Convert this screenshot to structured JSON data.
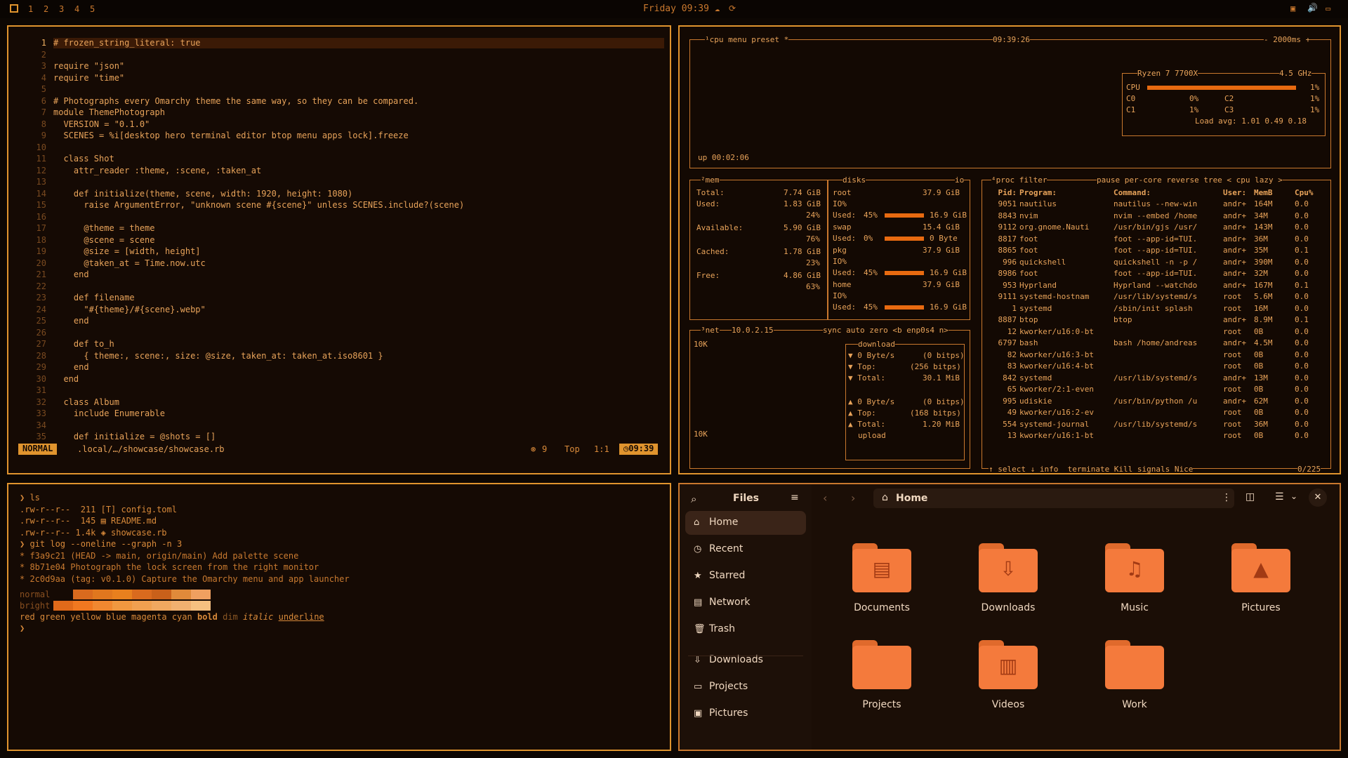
{
  "topbar": {
    "workspaces": [
      "1",
      "2",
      "3",
      "4",
      "5"
    ],
    "clock": "Friday 09:39"
  },
  "editor": {
    "lines": [
      "# frozen_string_literal: true",
      "",
      "require \"json\"",
      "require \"time\"",
      "",
      "# Photographs every Omarchy theme the same way, so they can be compared.",
      "module ThemePhotograph",
      "  VERSION = \"0.1.0\"",
      "  SCENES = %i[desktop hero terminal editor btop menu apps lock].freeze",
      "",
      "  class Shot",
      "    attr_reader :theme, :scene, :taken_at",
      "",
      "    def initialize(theme, scene, width: 1920, height: 1080)",
      "      raise ArgumentError, \"unknown scene #{scene}\" unless SCENES.include?(scene)",
      "",
      "      @theme = theme",
      "      @scene = scene",
      "      @size = [width, height]",
      "      @taken_at = Time.now.utc",
      "    end",
      "",
      "    def filename",
      "      \"#{theme}/#{scene}.webp\"",
      "    end",
      "",
      "    def to_h",
      "      { theme:, scene:, size: @size, taken_at: taken_at.iso8601 }",
      "    end",
      "  end",
      "",
      "  class Album",
      "    include Enumerable",
      "",
      "    def initialize = @shots = []"
    ],
    "status": {
      "mode": "NORMAL",
      "path": ".local/…/showcase/showcase.rb",
      "diag": "9",
      "pos": "Top",
      "cursor": "1:1",
      "time": "09:39"
    }
  },
  "btop": {
    "cpu": {
      "tabs": "¹cpu menu preset *",
      "time": "09:39:26",
      "refresh": "- 2000ms +",
      "model": "Ryzen 7 7700X",
      "freq": "4.5 GHz",
      "cpu_pct": "1%",
      "cores": [
        {
          "name": "C0",
          "pct": "0%"
        },
        {
          "name": "C2",
          "pct": "1%"
        },
        {
          "name": "C1",
          "pct": "1%"
        },
        {
          "name": "C3",
          "pct": "1%"
        }
      ],
      "load": "Load avg: 1.01 0.49 0.18",
      "uptime": "up 00:02:06"
    },
    "mem": {
      "title": "²mem",
      "total_label": "Total:",
      "total": "7.74 GiB",
      "used_label": "Used:",
      "used": "1.83 GiB",
      "used_pct": "24%",
      "avail_label": "Available:",
      "avail": "5.90 GiB",
      "avail_pct": "76%",
      "cached_label": "Cached:",
      "cached": "1.78 GiB",
      "cached_pct": "23%",
      "free_label": "Free:",
      "free": "4.86 GiB",
      "free_pct": "63%"
    },
    "disks": {
      "title": "disks",
      "io": "io",
      "items": [
        {
          "name": "root",
          "size": "37.9 GiB",
          "io": "IO%",
          "used_pct": "45%",
          "used": "16.9 GiB"
        },
        {
          "name": "swap",
          "size": "15.4 GiB",
          "io": "",
          "used_pct": "0%",
          "used": "0 Byte"
        },
        {
          "name": "pkg",
          "size": "37.9 GiB",
          "io": "IO%",
          "used_pct": "45%",
          "used": "16.9 GiB"
        },
        {
          "name": "home",
          "size": "37.9 GiB",
          "io": "IO%",
          "used_pct": "45%",
          "used": "16.9 GiB"
        }
      ]
    },
    "net": {
      "title": "³net",
      "ip": "10.0.2.15",
      "opts": "sync auto zero <b enp0s4 n>",
      "scale_top": "10K",
      "scale_bottom": "10K",
      "download_label": "download",
      "down_rate": "0 Byte/s",
      "down_bits": "(0 bitps)",
      "down_top": "(256 bitps)",
      "down_total": "30.1 MiB",
      "upload_label": "upload",
      "up_rate": "0 Byte/s",
      "up_bits": "(0 bitps)",
      "up_top": "(168 bitps)",
      "up_total": "1.20 MiB",
      "top_label": "Top:",
      "total_label": "Total:"
    },
    "proc": {
      "title": "⁴proc filter",
      "opts": "pause per-core reverse tree < cpu lazy >",
      "headers": [
        "Pid:",
        "Program:",
        "Command:",
        "User:",
        "MemB",
        "Cpu%"
      ],
      "rows": [
        [
          "9051",
          "nautilus",
          "nautilus --new-win",
          "andr+",
          "164M",
          "0.0"
        ],
        [
          "8843",
          "nvim",
          "nvim --embed /home",
          "andr+",
          "34M",
          "0.0"
        ],
        [
          "9112",
          "org.gnome.Nauti",
          "/usr/bin/gjs /usr/",
          "andr+",
          "143M",
          "0.0"
        ],
        [
          "8817",
          "foot",
          "foot --app-id=TUI.",
          "andr+",
          "36M",
          "0.0"
        ],
        [
          "8865",
          "foot",
          "foot --app-id=TUI.",
          "andr+",
          "35M",
          "0.1"
        ],
        [
          "996",
          "quickshell",
          "quickshell -n -p /",
          "andr+",
          "390M",
          "0.0"
        ],
        [
          "8986",
          "foot",
          "foot --app-id=TUI.",
          "andr+",
          "32M",
          "0.0"
        ],
        [
          "953",
          "Hyprland",
          "Hyprland --watchdo",
          "andr+",
          "167M",
          "0.1"
        ],
        [
          "9111",
          "systemd-hostnam",
          "/usr/lib/systemd/s",
          "root",
          "5.6M",
          "0.0"
        ],
        [
          "1",
          "systemd",
          "/sbin/init splash",
          "root",
          "16M",
          "0.0"
        ],
        [
          "8887",
          "btop",
          "btop",
          "andr+",
          "8.9M",
          "0.1"
        ],
        [
          "12",
          "kworker/u16:0-bt",
          "",
          "root",
          "0B",
          "0.0"
        ],
        [
          "6797",
          "bash",
          "bash /home/andreas",
          "andr+",
          "4.5M",
          "0.0"
        ],
        [
          "82",
          "kworker/u16:3-bt",
          "",
          "root",
          "0B",
          "0.0"
        ],
        [
          "83",
          "kworker/u16:4-bt",
          "",
          "root",
          "0B",
          "0.0"
        ],
        [
          "842",
          "systemd",
          "/usr/lib/systemd/s",
          "andr+",
          "13M",
          "0.0"
        ],
        [
          "65",
          "kworker/2:1-even",
          "",
          "root",
          "0B",
          "0.0"
        ],
        [
          "995",
          "udiskie",
          "/usr/bin/python /u",
          "andr+",
          "62M",
          "0.0"
        ],
        [
          "49",
          "kworker/u16:2-ev",
          "",
          "root",
          "0B",
          "0.0"
        ],
        [
          "554",
          "systemd-journal",
          "/usr/lib/systemd/s",
          "root",
          "36M",
          "0.0"
        ],
        [
          "13",
          "kworker/u16:1-bt",
          "",
          "root",
          "0B",
          "0.0"
        ]
      ],
      "footer": "↑ select ↓ info  terminate Kill signals Nice",
      "count": "0/225"
    }
  },
  "terminal": {
    "lines": [
      "❯ ls",
      ".rw-r--r--  211 [T] config.toml",
      ".rw-r--r--  145 ▤ README.md",
      ".rw-r--r-- 1.4k ◈ showcase.rb",
      "❯ git log --oneline --graph -n 3",
      "* f3a9c21 (HEAD -> main, origin/main) Add palette scene",
      "* 8b71e04 Photograph the lock screen from the right monitor",
      "* 2c0d9aa (tag: v0.1.0) Capture the Omarchy menu and app launcher"
    ],
    "normal_label": "normal",
    "bright_label": "bright",
    "palette_normal": [
      "#150a04",
      "#d96a1e",
      "#e0771e",
      "#e8801e",
      "#d96a1e",
      "#c9601a",
      "#e08a3a",
      "#f0a060"
    ],
    "palette_bright": [
      "#e06a1a",
      "#f07820",
      "#f08830",
      "#f09840",
      "#f0a050",
      "#f0a860",
      "#f0b070",
      "#f5c080"
    ],
    "styles": [
      "red",
      "green",
      "yellow",
      "blue",
      "magenta",
      "cyan",
      "bold",
      "dim",
      "italic",
      "underline"
    ],
    "prompt": "❯"
  },
  "files": {
    "title": "Files",
    "location": "Home",
    "sidebar": [
      {
        "label": "Home",
        "icon": "⌂"
      },
      {
        "label": "Recent",
        "icon": "◷"
      },
      {
        "label": "Starred",
        "icon": "★"
      },
      {
        "label": "Network",
        "icon": "▤"
      },
      {
        "label": "Trash",
        "icon": "🗑"
      },
      {
        "label": "Downloads",
        "icon": "⇩"
      },
      {
        "label": "Projects",
        "icon": "▭"
      },
      {
        "label": "Pictures",
        "icon": "▣"
      }
    ],
    "folders": [
      {
        "label": "Documents",
        "glyph": "▤"
      },
      {
        "label": "Downloads",
        "glyph": "⇩"
      },
      {
        "label": "Music",
        "glyph": "♫"
      },
      {
        "label": "Pictures",
        "glyph": "▲"
      },
      {
        "label": "Projects",
        "glyph": ""
      },
      {
        "label": "Videos",
        "glyph": "▥"
      },
      {
        "label": "Work",
        "glyph": ""
      }
    ]
  },
  "colors": {
    "accent": "#e0942e",
    "folder": "#f47a3c",
    "bg": "#150a04"
  }
}
